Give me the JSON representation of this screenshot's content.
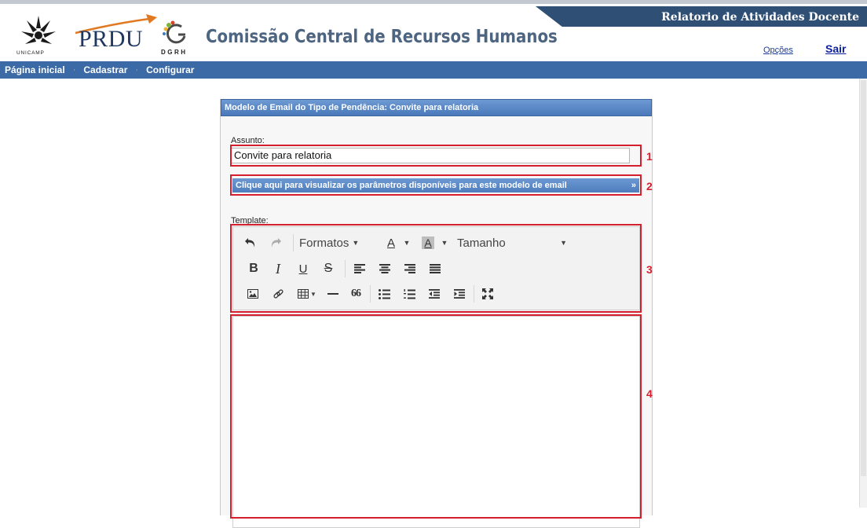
{
  "header": {
    "system_title": "Relatorio de Atividades Docente",
    "unicamp_label": "UNICAMP",
    "prdu_label": "PRDU",
    "dgrh_label": "DGRH",
    "committee_title": "Comissão Central de Recursos Humanos",
    "options_link": "Opções",
    "logout_link": "Sair"
  },
  "nav": {
    "items": [
      "Página inicial",
      "Cadastrar",
      "Configurar"
    ]
  },
  "panel": {
    "title": "Modelo de Email do Tipo de Pendência: Convite para relatoria",
    "subject_label": "Assunto:",
    "subject_value": "Convite para relatoria",
    "params_link": "Clique aqui para visualizar os parâmetros disponíveis para este modelo de email",
    "params_arrow": "»",
    "template_label": "Template:"
  },
  "toolbar": {
    "formats_label": "Formatos",
    "size_label": "Tamanho",
    "bold": "B",
    "italic": "I",
    "underline": "U",
    "strike": "S",
    "font_color_letter": "A",
    "bg_color_letter": "A",
    "quote": "66"
  },
  "annotations": [
    "1",
    "2",
    "3",
    "4"
  ],
  "colors": {
    "nav_bar": "#3c6aa6",
    "title_bar": "#2f4f74",
    "annotation_red": "#d51f2f"
  }
}
